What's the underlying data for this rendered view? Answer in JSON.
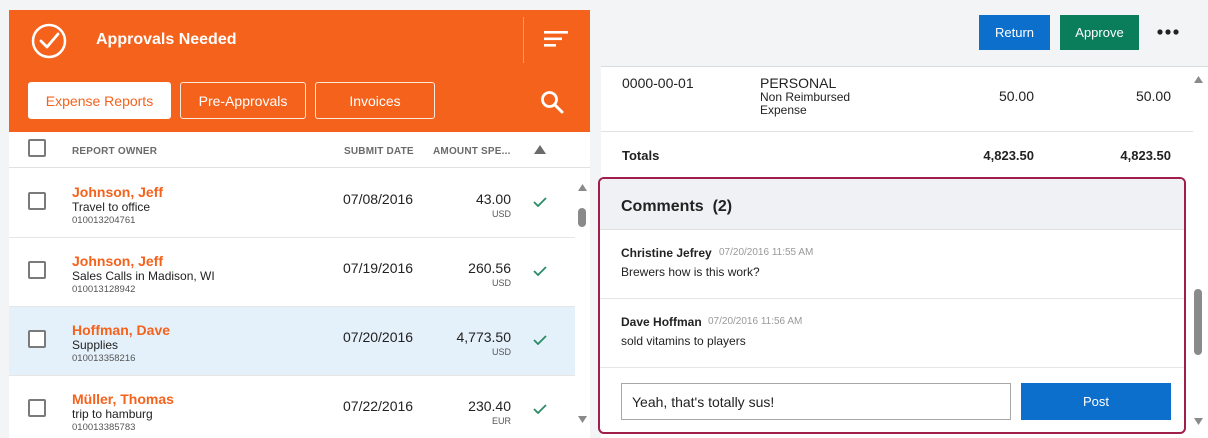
{
  "header": {
    "title": "Approvals Needed",
    "tabs": [
      {
        "label": "Expense Reports",
        "active": true
      },
      {
        "label": "Pre-Approvals",
        "active": false
      },
      {
        "label": "Invoices",
        "active": false
      }
    ],
    "icons": [
      "check-circle-icon",
      "sort-icon",
      "search-icon"
    ],
    "accent": "#f5621c"
  },
  "columns": {
    "owner": "REPORT OWNER",
    "date": "SUBMIT DATE",
    "amount": "AMOUNT SPE..."
  },
  "reports": [
    {
      "name": "Johnson, Jeff",
      "desc": "Travel to office",
      "id": "010013204761",
      "date": "07/08/2016",
      "amount": "43.00",
      "currency": "USD",
      "selected": false
    },
    {
      "name": "Johnson, Jeff",
      "desc": "Sales Calls in Madison, WI",
      "id": "010013128942",
      "date": "07/19/2016",
      "amount": "260.56",
      "currency": "USD",
      "selected": false
    },
    {
      "name": "Hoffman, Dave",
      "desc": "Supplies",
      "id": "010013358216",
      "date": "07/20/2016",
      "amount": "4,773.50",
      "currency": "USD",
      "selected": true
    },
    {
      "name": "Müller, Thomas",
      "desc": "trip to hamburg",
      "id": "010013385783",
      "date": "07/22/2016",
      "amount": "230.40",
      "currency": "EUR",
      "selected": false
    }
  ],
  "actions": {
    "return": "Return",
    "approve": "Approve",
    "return_color": "#0b6fcb",
    "approve_color": "#0a7d5a"
  },
  "line_item": {
    "account": "0000-00-01",
    "type": "PERSONAL",
    "sub1": "Non Reimbursed",
    "sub2": "Expense",
    "amount1": "50.00",
    "amount2": "50.00"
  },
  "totals": {
    "label": "Totals",
    "amount1": "4,823.50",
    "amount2": "4,823.50"
  },
  "comments": {
    "title": "Comments",
    "count": "(2)",
    "items": [
      {
        "author": "Christine Jefrey",
        "time": "07/20/2016 11:55 AM",
        "text": "Brewers how is this work?"
      },
      {
        "author": "Dave Hoffman",
        "time": "07/20/2016 11:56 AM",
        "text": "sold vitamins to players"
      }
    ],
    "input_value": "Yeah, that's totally sus!",
    "post_label": "Post"
  }
}
